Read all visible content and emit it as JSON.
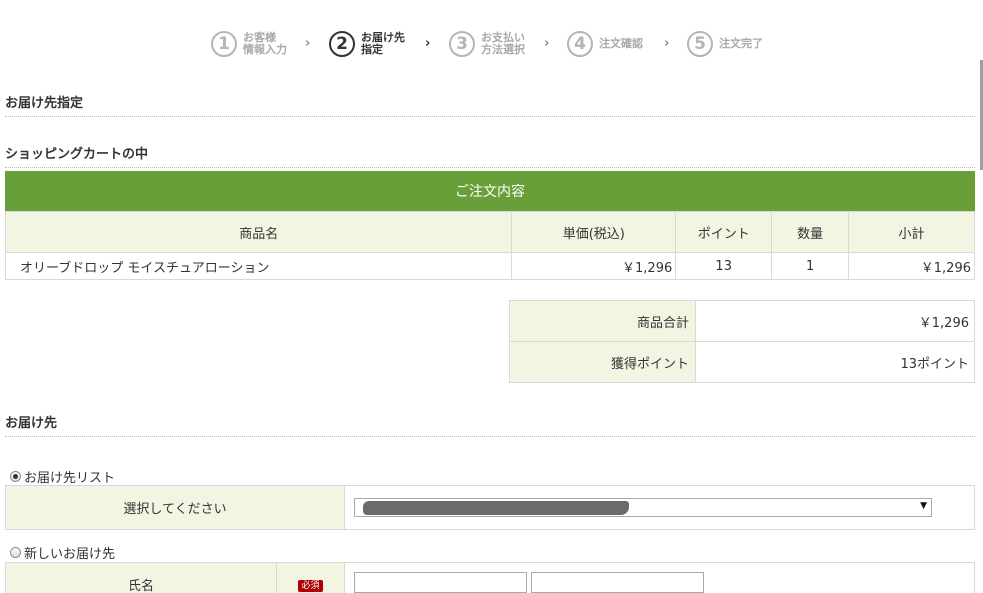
{
  "steps": [
    {
      "num": "1",
      "label": "お客様\n情報入力"
    },
    {
      "num": "2",
      "label": "お届け先\n指定"
    },
    {
      "num": "3",
      "label": "お支払い\n方法選択"
    },
    {
      "num": "4",
      "label": "注文確認"
    },
    {
      "num": "5",
      "label": "注文完了"
    }
  ],
  "arrow": "›",
  "headings": {
    "delivery_spec": "お届け先指定",
    "cart": "ショッピングカートの中",
    "delivery": "お届け先"
  },
  "cart": {
    "header": "ご注文内容",
    "columns": [
      "商品名",
      "単価(税込)",
      "ポイント",
      "数量",
      "小計"
    ],
    "rows": [
      {
        "name": "オリーブドロップ モイスチュアローション",
        "price": "￥1,296",
        "points": "13",
        "qty": "1",
        "subtotal": "￥1,296"
      }
    ]
  },
  "totals": {
    "subtotal_label": "商品合計",
    "subtotal_value": "￥1,296",
    "points_label": "獲得ポイント",
    "points_value": "13ポイント"
  },
  "address": {
    "list_radio": "お届け先リスト",
    "select_label": "選択してください",
    "select_caret": "▼",
    "new_radio": "新しいお届け先",
    "name_label": "氏名",
    "required": "必須"
  }
}
